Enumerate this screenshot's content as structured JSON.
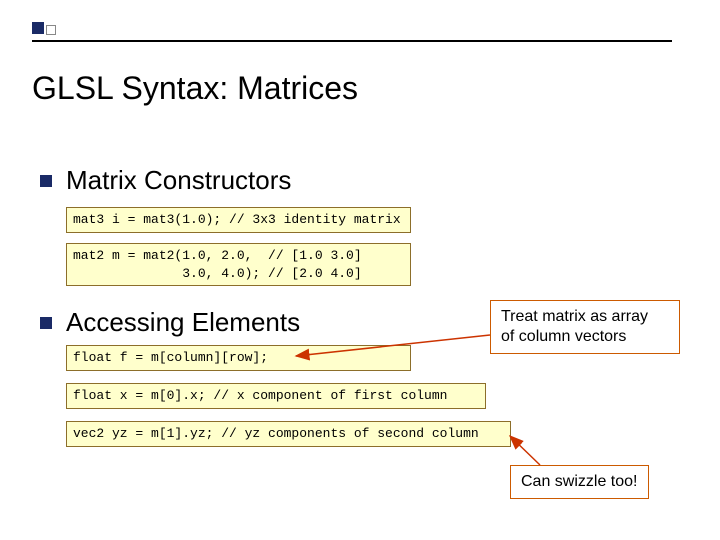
{
  "title": "GLSL Syntax:  Matrices",
  "section1": "Matrix Constructors",
  "code1": "mat3 i = mat3(1.0); // 3x3 identity matrix",
  "code2": "mat2 m = mat2(1.0, 2.0,  // [1.0 3.0]\n              3.0, 4.0); // [2.0 4.0]",
  "section2": "Accessing Elements",
  "code3": "float f = m[column][row];",
  "code4": "float x = m[0].x; // x component of first column",
  "code5": "vec2 yz = m[1].yz; // yz components of second column",
  "callout1": "Treat matrix as array\nof column vectors",
  "callout2": "Can swizzle too!"
}
